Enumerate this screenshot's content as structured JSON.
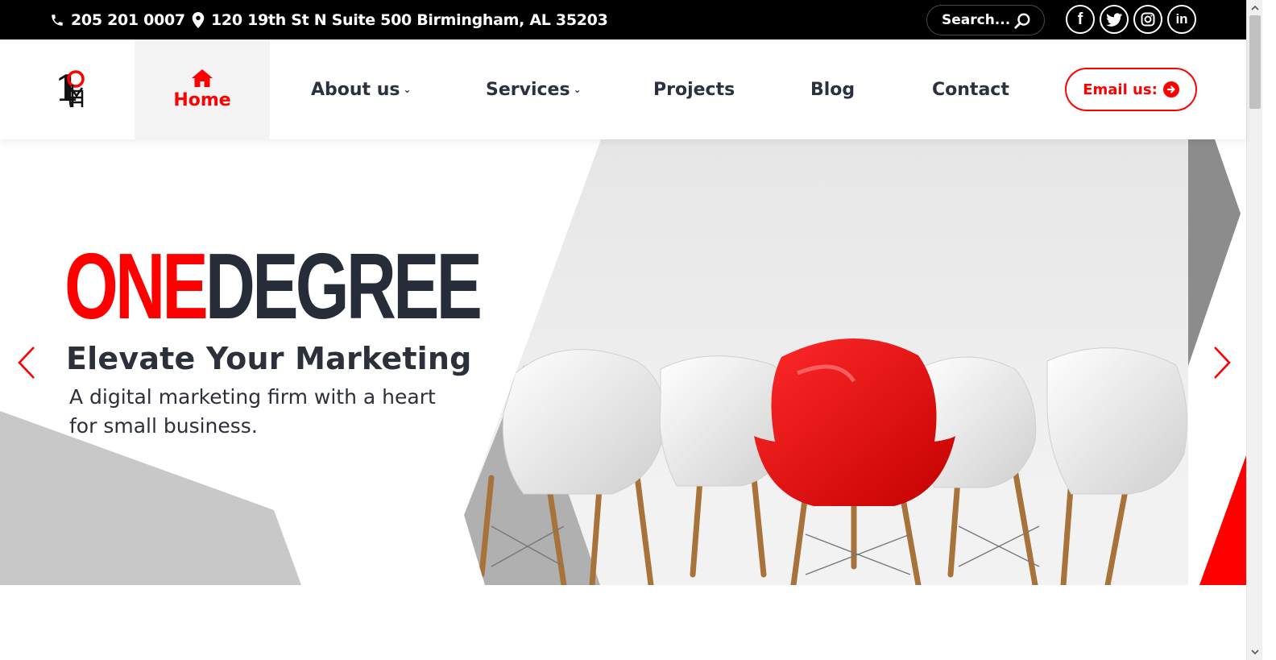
{
  "topbar": {
    "phone": "205 201 0007",
    "address": "120 19th St N Suite 500 Birmingham, AL 35203",
    "search_placeholder": "Search...",
    "social": [
      {
        "icon": "facebook-icon",
        "glyph": "f"
      },
      {
        "icon": "twitter-icon",
        "glyph": "t"
      },
      {
        "icon": "instagram-icon",
        "glyph": "ig"
      },
      {
        "icon": "linkedin-icon",
        "glyph": "in"
      }
    ]
  },
  "nav": {
    "items": [
      {
        "label": "Home",
        "active": true,
        "icon": "home-icon"
      },
      {
        "label": "About us",
        "has_dropdown": true
      },
      {
        "label": "Services",
        "has_dropdown": true
      },
      {
        "label": "Projects"
      },
      {
        "label": "Blog"
      },
      {
        "label": "Contact"
      }
    ],
    "email_button": "Email us:"
  },
  "hero": {
    "brand_part1": "ONE",
    "brand_part2": "DEGREE",
    "headline": "Elevate Your Marketing",
    "subtext": "A digital marketing firm with a heart for small business."
  },
  "colors": {
    "accent": "#ff0000",
    "dark_text": "#272d38",
    "topbar_bg": "#000000",
    "grey_shape": "#c8c8c8"
  }
}
